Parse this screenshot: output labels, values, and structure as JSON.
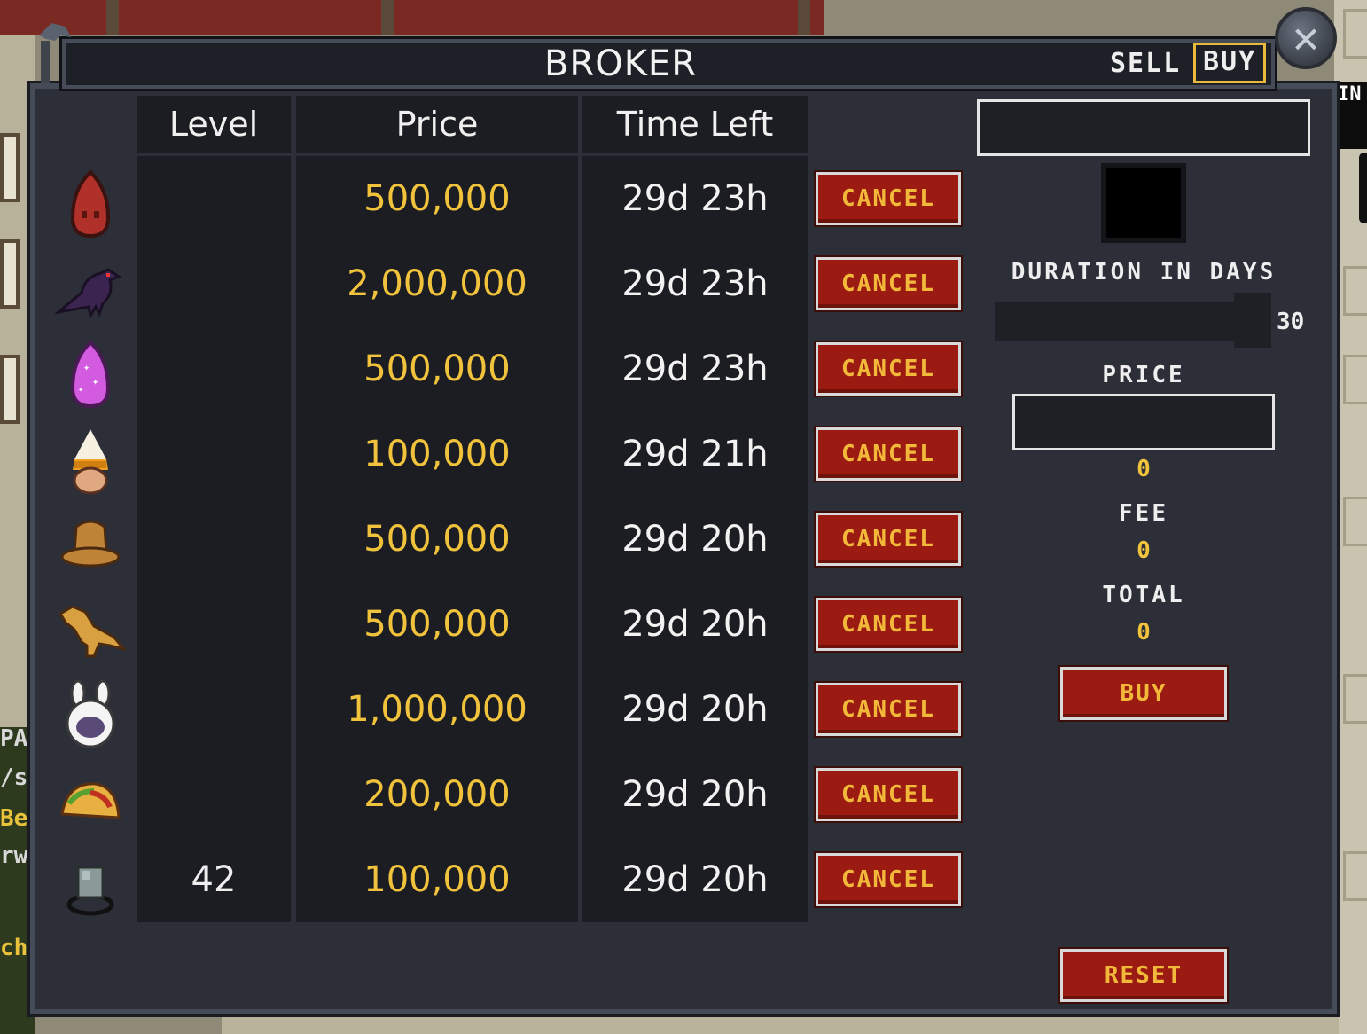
{
  "window": {
    "title": "BROKER",
    "close_icon": "close-x-icon",
    "tabs": [
      {
        "label": "SELL",
        "active": false
      },
      {
        "label": "BUY",
        "active": true
      }
    ]
  },
  "table": {
    "headers": {
      "level": "Level",
      "price": "Price",
      "time_left": "Time Left"
    },
    "rows": [
      {
        "icon": "red-ghost-hood-icon",
        "level": "",
        "price": "500,000",
        "time_left": "29d 23h",
        "action": "CANCEL"
      },
      {
        "icon": "crow-icon",
        "level": "",
        "price": "2,000,000",
        "time_left": "29d 23h",
        "action": "CANCEL"
      },
      {
        "icon": "pink-sparkle-hood-icon",
        "level": "",
        "price": "500,000",
        "time_left": "29d 23h",
        "action": "CANCEL"
      },
      {
        "icon": "candy-corn-helmet-icon",
        "level": "",
        "price": "100,000",
        "time_left": "29d 21h",
        "action": "CANCEL"
      },
      {
        "icon": "brown-hat-icon",
        "level": "",
        "price": "500,000",
        "time_left": "29d 20h",
        "action": "CANCEL"
      },
      {
        "icon": "dino-icon",
        "level": "",
        "price": "500,000",
        "time_left": "29d 20h",
        "action": "CANCEL"
      },
      {
        "icon": "bunny-hood-icon",
        "level": "",
        "price": "1,000,000",
        "time_left": "29d 20h",
        "action": "CANCEL"
      },
      {
        "icon": "taco-icon",
        "level": "",
        "price": "200,000",
        "time_left": "29d 20h",
        "action": "CANCEL"
      },
      {
        "icon": "stone-ring-icon",
        "level": "42",
        "price": "100,000",
        "time_left": "29d 20h",
        "action": "CANCEL"
      }
    ]
  },
  "buy_panel": {
    "search_value": "",
    "duration_label": "DURATION IN DAYS",
    "duration_value": "30",
    "duration_fraction": 1.0,
    "price_label": "PRICE",
    "price_input": "",
    "price_value": "0",
    "fee_label": "FEE",
    "fee_value": "0",
    "total_label": "TOTAL",
    "total_value": "0",
    "buy_button": "BUY",
    "reset_button": "RESET"
  },
  "background": {
    "right_partial_text": "IN",
    "chat_fragments": [
      "PA",
      "/s",
      "Be",
      "rw",
      "ch"
    ]
  },
  "colors": {
    "price_yellow": "#f1c33c",
    "button_red": "#9b1a12",
    "active_tab_border": "#e8b93a",
    "panel_bg": "#2c2f38",
    "column_bg": "#1b1d22"
  }
}
